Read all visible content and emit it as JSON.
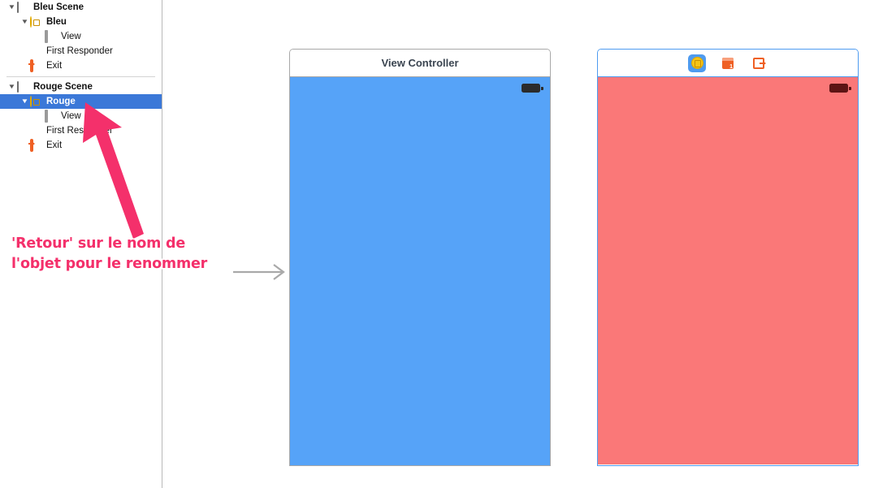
{
  "outline": {
    "rows": [
      {
        "id": "bleu-scene",
        "label": "Bleu Scene",
        "icon": "scene-icon",
        "indent": 0,
        "disclosure": "▼",
        "style": "scene",
        "selected": false
      },
      {
        "id": "bleu",
        "label": "Bleu",
        "icon": "view-controller-icon",
        "indent": 1,
        "disclosure": "▼",
        "style": "object",
        "selected": false
      },
      {
        "id": "bleu-view",
        "label": "View",
        "icon": "view-icon",
        "indent": 2,
        "disclosure": "",
        "style": "plain",
        "selected": false
      },
      {
        "id": "bleu-first-responder",
        "label": "First Responder",
        "icon": "first-responder-icon",
        "indent": 1,
        "disclosure": "",
        "style": "plain",
        "selected": false
      },
      {
        "id": "bleu-exit",
        "label": "Exit",
        "icon": "exit-icon",
        "indent": 1,
        "disclosure": "",
        "style": "plain",
        "selected": false
      },
      {
        "id": "separator",
        "label": "",
        "icon": "separator",
        "indent": 0,
        "disclosure": "",
        "style": "sep",
        "selected": false
      },
      {
        "id": "rouge-scene",
        "label": "Rouge Scene",
        "icon": "scene-icon",
        "indent": 0,
        "disclosure": "▼",
        "style": "scene",
        "selected": false
      },
      {
        "id": "rouge",
        "label": "Rouge",
        "icon": "view-controller-icon",
        "indent": 1,
        "disclosure": "▼",
        "style": "object",
        "selected": true
      },
      {
        "id": "rouge-view",
        "label": "View",
        "icon": "view-icon",
        "indent": 2,
        "disclosure": "",
        "style": "plain",
        "selected": false
      },
      {
        "id": "rouge-first-responder",
        "label": "First Responder",
        "icon": "first-responder-icon",
        "indent": 1,
        "disclosure": "",
        "style": "plain",
        "selected": false
      },
      {
        "id": "rouge-exit",
        "label": "Exit",
        "icon": "exit-icon",
        "indent": 1,
        "disclosure": "",
        "style": "plain",
        "selected": false
      }
    ]
  },
  "annotation": {
    "line1": "'Retour' sur le nom de",
    "line2": "l'objet pour le renommer",
    "text_color": "#f4306b",
    "outline_color": "#ffffff",
    "pointer_color": "#f4306b",
    "callout_arrow_color": "#a9a9a9"
  },
  "canvas": {
    "scenes": [
      {
        "id": "blue-scene",
        "title": "View Controller",
        "selected": false,
        "view_color": "#56a3f8",
        "border_color": "#a8a8a8",
        "status_bar": {
          "battery": "battery-icon"
        },
        "dock": []
      },
      {
        "id": "red-scene",
        "title": "",
        "selected": true,
        "view_color": "#fa7878",
        "border_color": "#4e9bf0",
        "status_bar": {
          "battery": "battery-icon"
        },
        "dock": [
          {
            "id": "dock-view-controller",
            "icon": "view-controller-icon",
            "selected": true
          },
          {
            "id": "dock-first-responder",
            "icon": "first-responder-icon",
            "selected": false
          },
          {
            "id": "dock-exit",
            "icon": "exit-icon",
            "selected": false
          }
        ]
      }
    ]
  }
}
